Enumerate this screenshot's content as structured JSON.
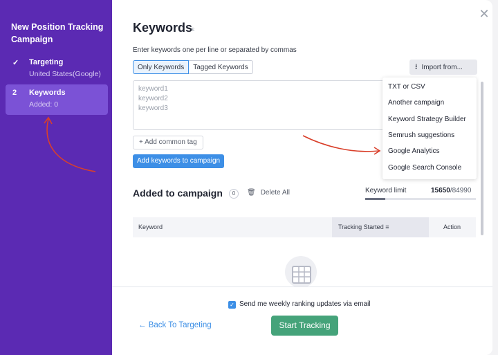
{
  "sidebar": {
    "title": "New Position Tracking Campaign",
    "steps": [
      {
        "num": "✓",
        "label": "Targeting",
        "sub": "United States(Google)"
      },
      {
        "num": "2",
        "label": "Keywords",
        "sub": "Added: 0"
      }
    ]
  },
  "modal": {
    "title": "Keywords",
    "info_icon": "ɛ",
    "instructions": "Enter keywords one per line or separated by commas",
    "tabs": [
      "Only Keywords",
      "Tagged Keywords"
    ],
    "import_label": "Import from...",
    "textarea_placeholder": [
      "keyword1",
      "keyword2",
      "keyword3"
    ],
    "add_common_tag": "+ Add common tag",
    "add_keywords_button": "Add keywords to campaign",
    "import_menu": [
      "TXT or CSV",
      "Another campaign",
      "Keyword Strategy Builder",
      "Semrush suggestions",
      "Google Analytics",
      "Google Search Console"
    ],
    "added_title": "Added to campaign",
    "added_count": "0",
    "delete_all": "Delete All",
    "keyword_limit_label": "Keyword limit",
    "keyword_limit_used": "15650",
    "keyword_limit_total": "/84990",
    "keyword_limit_fraction": 0.184,
    "table_columns": [
      "Keyword",
      "Tracking Started",
      "Action"
    ],
    "email_checkbox_label": "Send me weekly ranking updates via email",
    "back_label": "Back To Targeting",
    "start_label": "Start Tracking",
    "close_icon": "✕"
  },
  "colors": {
    "sidebar": "#5b2ab3",
    "active_step": "#7b52d6",
    "accent_blue": "#3d8fe6",
    "start_green": "#45a37a",
    "annotation_arrow": "#d9402b"
  }
}
